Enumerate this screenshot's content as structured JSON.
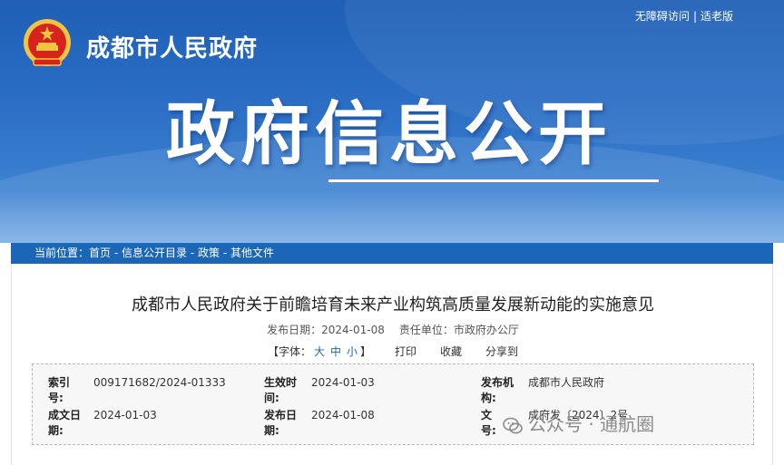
{
  "header": {
    "site_name": "成都市人民政府",
    "top_links": [
      "无障碍访问",
      "适老版"
    ],
    "top_sep": "|",
    "big_title": "政府信息公开"
  },
  "breadcrumb": {
    "prefix": "当前位置：",
    "items": [
      "首页",
      "信息公开目录",
      "政策",
      "其他文件"
    ],
    "sep": " - "
  },
  "article": {
    "title": "成都市人民政府关于前瞻培育未来产业构筑高质量发展新动能的实施意见",
    "publish_label": "发布日期：",
    "publish_date": "2024-01-08",
    "owner_label": "责任单位：",
    "owner": "市政府办公厅",
    "font_label": "【字体：",
    "font_sizes": [
      "大",
      "中",
      "小"
    ],
    "font_close": "】",
    "actions": [
      "打印",
      "收藏",
      "分享到"
    ]
  },
  "info": {
    "index_label_1": "索引",
    "index_label_2": "号:",
    "index_value": "009171682/2024-01333",
    "effect_label_1": "生效时",
    "effect_label_2": "间:",
    "effect_value": "2024-01-03",
    "issuer_label_1": "发布机",
    "issuer_label_2": "构:",
    "issuer_value": "成都市人民政府",
    "made_label_1": "成文日",
    "made_label_2": "期:",
    "made_value": "2024-01-03",
    "pub_label_1": "发布日",
    "pub_label_2": "期:",
    "pub_value": "2024-01-08",
    "docno_label_1": "文",
    "docno_label_2": "号:",
    "docno_value": "成府发〔2024〕2号"
  },
  "watermark": "公众号 · 通航圈",
  "colors": {
    "banner": "#2a6dc4",
    "breadcrumb_bar": "#1c66b8",
    "emblem_red": "#d8221c",
    "emblem_gold": "#f3c443"
  }
}
